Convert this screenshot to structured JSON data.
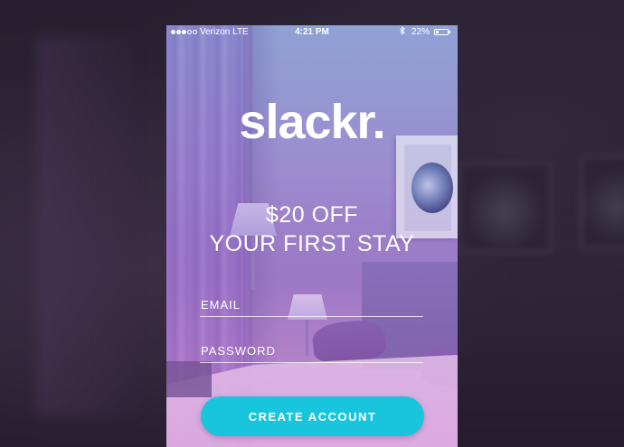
{
  "status_bar": {
    "signal_full": 3,
    "signal_total": 5,
    "carrier": "Verizon LTE",
    "time": "4:21 PM",
    "bluetooth_icon": "bluetooth-icon",
    "battery": "22%",
    "battery_level": 0.22
  },
  "brand": {
    "logo": "slackr."
  },
  "promo": {
    "line1": "$20 OFF",
    "line2": "YOUR FIRST STAY"
  },
  "form": {
    "email_placeholder": "EMAIL",
    "password_placeholder": "PASSWORD",
    "submit_label": "CREATE ACCOUNT"
  },
  "colors": {
    "accent": "#19c5dc",
    "text": "#ffffff"
  }
}
